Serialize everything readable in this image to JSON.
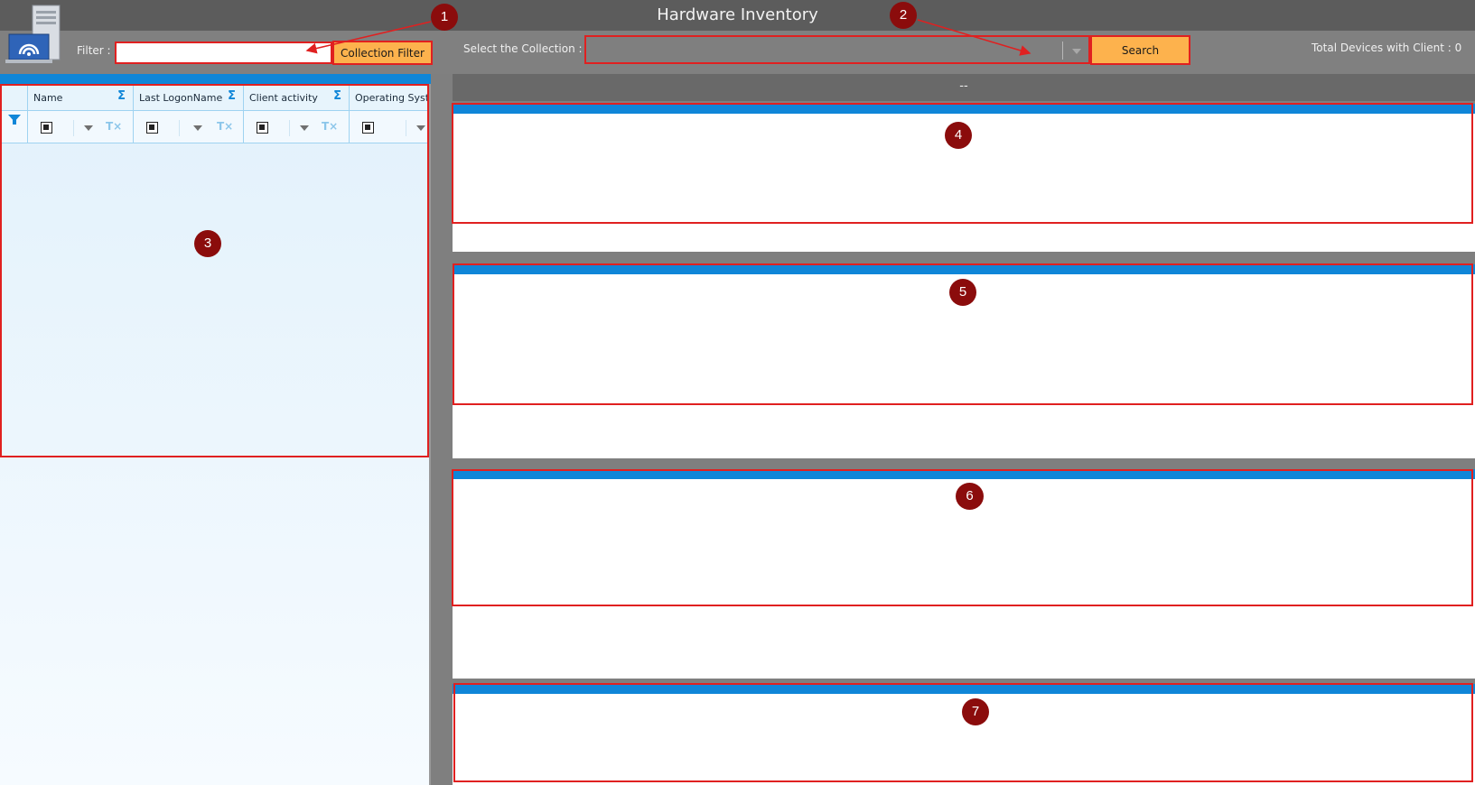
{
  "window": {
    "title": "Hardware Inventory"
  },
  "toolbar": {
    "filter_label": "Filter :",
    "filter_value": "",
    "collection_filter_label": "Collection Filter",
    "select_collection_label": "Select the Collection :",
    "collection_selected": "",
    "search_label": "Search",
    "total_devices_label": "Total Devices with Client : 0"
  },
  "grid": {
    "columns": [
      {
        "label": "Name"
      },
      {
        "label": "Last LogonName"
      },
      {
        "label": "Client activity"
      },
      {
        "label": "Operating Syster"
      }
    ],
    "sigma": "Σ",
    "clear_filter": "T×"
  },
  "details": {
    "header": "--"
  },
  "callouts": [
    "1",
    "2",
    "3",
    "4",
    "5",
    "6",
    "7"
  ],
  "colors": {
    "accent": "#0f86d8",
    "button": "#fdb24d",
    "highlight": "#e02020",
    "badge": "#8b0c0c"
  }
}
